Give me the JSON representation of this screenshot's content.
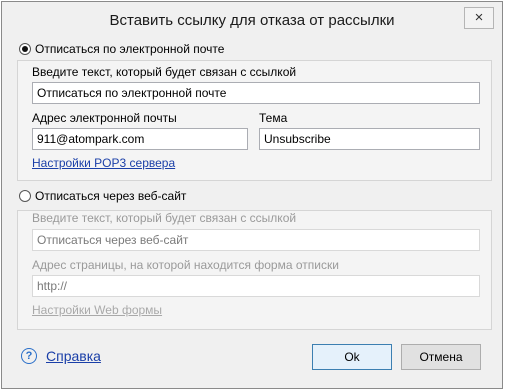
{
  "dialog": {
    "title": "Вставить ссылку для отказа от рассылки",
    "close_glyph": "×"
  },
  "email_option": {
    "radio_label": "Отписаться по электронной почте",
    "checked": true,
    "text_label": "Введите текст, который будет связан с ссылкой",
    "text_value": "Отписаться по электронной почте",
    "email_label": "Адрес электронной почты",
    "email_value": "911@atompark.com",
    "subject_label": "Тема",
    "subject_value": "Unsubscribe",
    "pop3_link": "Настройки POP3 сервера"
  },
  "web_option": {
    "radio_label": "Отписаться через веб-сайт",
    "checked": false,
    "text_label": "Введите текст, который будет связан с ссылкой",
    "text_value": "Отписаться через веб-сайт",
    "url_label": "Адрес страницы, на которой находится форма отписки",
    "url_value": "http://",
    "web_form_link": "Настройки Web формы"
  },
  "footer": {
    "help_icon": "question-circle",
    "help_glyph": "?",
    "help_label": "Справка",
    "ok_label": "Ok",
    "cancel_label": "Отмена"
  }
}
